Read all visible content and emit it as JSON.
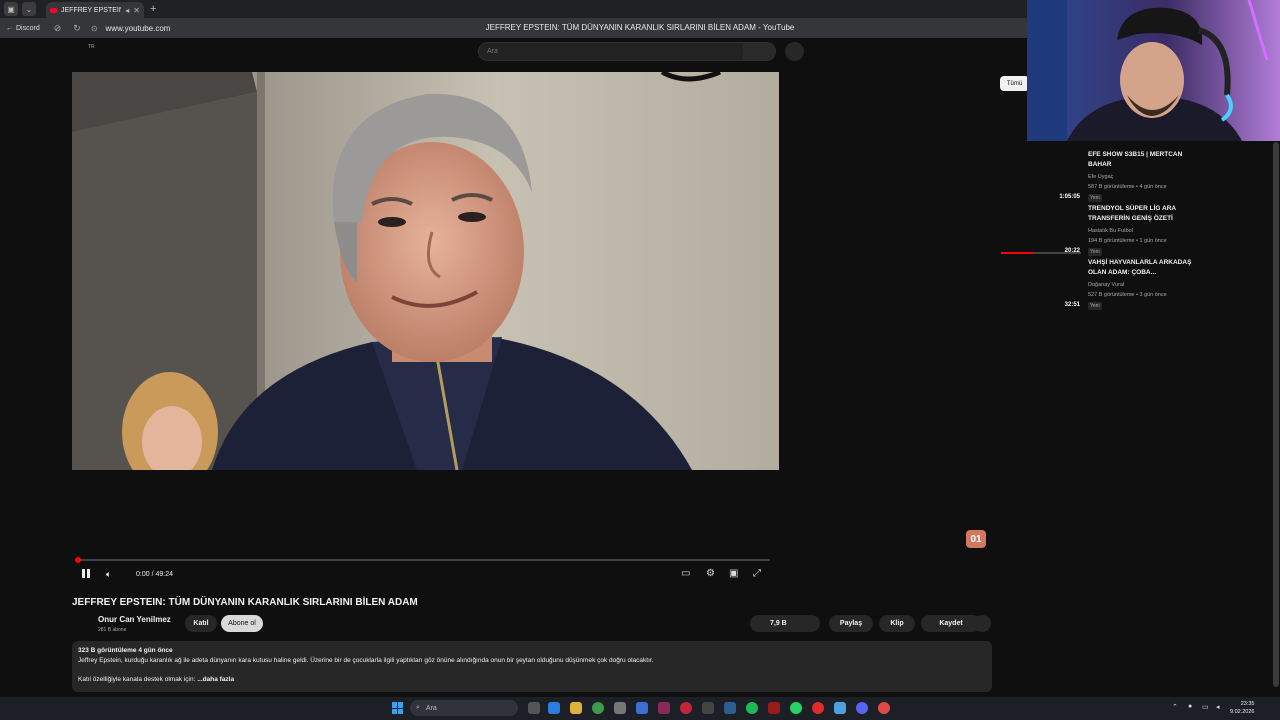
{
  "browser": {
    "tab_title": "JEFFREY EPSTEIN: T",
    "back_label": "Discord",
    "url": "www.youtube.com",
    "page_title": "JEFFREY EPSTEIN: TÜM DÜNYANIN KARANLIK SIRLARINI BİLEN ADAM - YouTube"
  },
  "youtube": {
    "locale": "TR",
    "search_placeholder": "Ara"
  },
  "player": {
    "time": "0:00 / 49:24",
    "progress": 0,
    "accent": "#ff0000"
  },
  "video": {
    "title": "JEFFREY EPSTEIN: TÜM DÜNYANIN KARANLIK SIRLARINI BİLEN ADAM",
    "channel": "Onur Can Yenilmez",
    "subscribers": "281 B abone",
    "join_label": "Katıl",
    "subscribe_label": "Abone ol",
    "likes": "7,9 B",
    "share_label": "Paylaş",
    "clip_label": "Klip",
    "save_label": "Kaydet",
    "description": {
      "stats": "323 B görüntüleme  4 gün önce",
      "text": "Jeffrey Epstein, kurduğu karanlık ağ ile adeta dünyanın kara kutusu haline geldi. Üzerine bir de çocuklarla ilgili yaptıkları göz önüne alındığında onun bir şeytan olduğunu düşünmek çok doğru olacaktır.",
      "support": "Katıl özelliğiyle kanala destek olmak için:",
      "more": "...daha fazla"
    }
  },
  "sidebar": {
    "chip_all": "Tümü",
    "overlay_badge": "01",
    "recommendations": [
      {
        "title": "EFE SHOW S3B15 | MERTCAN BAHAR",
        "channel": "Efe Uygaç",
        "meta": "587 B görüntüleme • 4 gün önce",
        "badge": "Yeni",
        "duration": "1:05:05"
      },
      {
        "title": "TRENDYOL SÜPER LİG ARA TRANSFERİN GENİŞ ÖZETİ",
        "channel": "Hastalık Bu Futbol",
        "meta": "194 B görüntüleme • 1 gün önce",
        "badge": "Yeni",
        "duration": "20:22"
      },
      {
        "title": "VAHŞİ HAYVANLARLA ARKADAŞ OLAN ADAM: ÇOBA...",
        "channel": "Doğanay Vural",
        "meta": "527 B görüntüleme • 3 gün önce",
        "badge": "Yeni",
        "duration": "32:51"
      }
    ]
  },
  "taskbar": {
    "search_placeholder": "Ara",
    "time": "23:35",
    "date": "9.02.2026"
  }
}
